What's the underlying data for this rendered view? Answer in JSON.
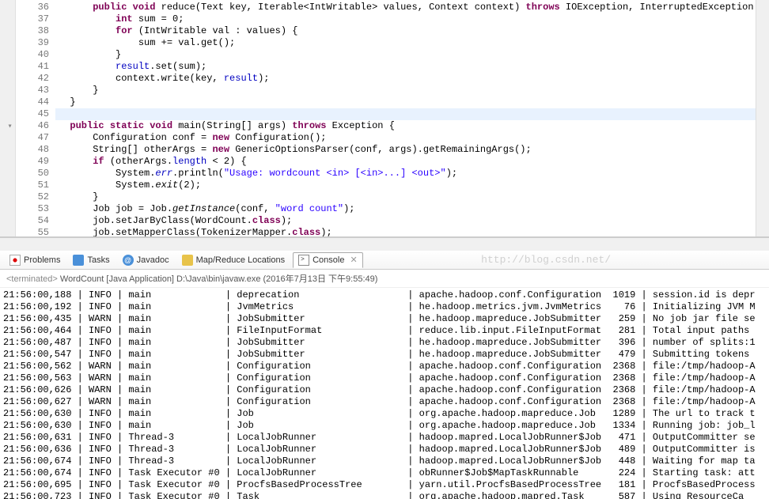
{
  "editor": {
    "gutter_start": 36,
    "lines": [
      {
        "n": 36,
        "partial": true,
        "html": "      <span class='kw'>public void</span> reduce(Text key, Iterable&lt;IntWritable&gt; values, Context context) <span class='kw'>throws</span> IOException, InterruptedException {"
      },
      {
        "n": 37,
        "html": "          <span class='kw'>int</span> sum = 0;"
      },
      {
        "n": 38,
        "html": "          <span class='kw'>for</span> (IntWritable val : values) {"
      },
      {
        "n": 39,
        "html": "              sum += val.get();"
      },
      {
        "n": 40,
        "html": "          }"
      },
      {
        "n": 41,
        "html": "          <span class='field'>result</span>.set(sum);"
      },
      {
        "n": 42,
        "html": "          context.write(key, <span class='field'>result</span>);"
      },
      {
        "n": 43,
        "html": "      }"
      },
      {
        "n": 44,
        "html": "  }"
      },
      {
        "n": 45,
        "html": " ",
        "hl": true
      },
      {
        "n": 46,
        "fold": true,
        "html": "  <span class='kw'>public static void</span> main(String[] args) <span class='kw'>throws</span> Exception {"
      },
      {
        "n": 47,
        "html": "      Configuration conf = <span class='kw'>new</span> Configuration();"
      },
      {
        "n": 48,
        "html": "      String[] otherArgs = <span class='kw'>new</span> GenericOptionsParser(conf, args).getRemainingArgs();"
      },
      {
        "n": 49,
        "html": "      <span class='kw'>if</span> (otherArgs.<span class='field'>length</span> &lt; 2) {"
      },
      {
        "n": 50,
        "html": "          System.<span class='field method-ital'>err</span>.println(<span class='str'>\"Usage: wordcount &lt;in&gt; [&lt;in&gt;...] &lt;out&gt;\"</span>);"
      },
      {
        "n": 51,
        "html": "          System.<span class='method-ital'>exit</span>(2);"
      },
      {
        "n": 52,
        "html": "      }"
      },
      {
        "n": 53,
        "html": "      Job job = Job.<span class='method-ital'>getInstance</span>(conf, <span class='str'>\"word count\"</span>);"
      },
      {
        "n": 54,
        "html": "      job.setJarByClass(WordCount.<span class='kw'>class</span>);"
      },
      {
        "n": 55,
        "html": "      job.setMapperClass(TokenizerMapper.<span class='kw'>class</span>);"
      }
    ]
  },
  "tabs": {
    "problems": "Problems",
    "tasks": "Tasks",
    "javadoc": "Javadoc",
    "mapreduce": "Map/Reduce Locations",
    "console": "Console",
    "watermark": "http://blog.csdn.net/"
  },
  "console": {
    "header_prefix": "<terminated>",
    "header_main": "WordCount [Java Application] D:\\Java\\bin\\javaw.exe (2016年7月13日 下午9:55:49)",
    "rows": [
      {
        "time": "21:56:00,188",
        "lvl": "INFO",
        "thread": "main",
        "cat": "deprecation",
        "cls": "apache.hadoop.conf.Configuration",
        "ln": "1019",
        "msg": "session.id is depr"
      },
      {
        "time": "21:56:00,192",
        "lvl": "INFO",
        "thread": "main",
        "cat": "JvmMetrics",
        "cls": "he.hadoop.metrics.jvm.JvmMetrics",
        "ln": "76",
        "msg": "Initializing JVM M"
      },
      {
        "time": "21:56:00,435",
        "lvl": "WARN",
        "thread": "main",
        "cat": "JobSubmitter",
        "cls": "he.hadoop.mapreduce.JobSubmitter",
        "ln": "259",
        "msg": "No job jar file se"
      },
      {
        "time": "21:56:00,464",
        "lvl": "INFO",
        "thread": "main",
        "cat": "FileInputFormat",
        "cls": "reduce.lib.input.FileInputFormat",
        "ln": "281",
        "msg": "Total input paths"
      },
      {
        "time": "21:56:00,487",
        "lvl": "INFO",
        "thread": "main",
        "cat": "JobSubmitter",
        "cls": "he.hadoop.mapreduce.JobSubmitter",
        "ln": "396",
        "msg": "number of splits:1"
      },
      {
        "time": "21:56:00,547",
        "lvl": "INFO",
        "thread": "main",
        "cat": "JobSubmitter",
        "cls": "he.hadoop.mapreduce.JobSubmitter",
        "ln": "479",
        "msg": "Submitting tokens"
      },
      {
        "time": "21:56:00,562",
        "lvl": "WARN",
        "thread": "main",
        "cat": "Configuration",
        "cls": "apache.hadoop.conf.Configuration",
        "ln": "2368",
        "msg": "file:/tmp/hadoop-A"
      },
      {
        "time": "21:56:00,563",
        "lvl": "WARN",
        "thread": "main",
        "cat": "Configuration",
        "cls": "apache.hadoop.conf.Configuration",
        "ln": "2368",
        "msg": "file:/tmp/hadoop-A"
      },
      {
        "time": "21:56:00,626",
        "lvl": "WARN",
        "thread": "main",
        "cat": "Configuration",
        "cls": "apache.hadoop.conf.Configuration",
        "ln": "2368",
        "msg": "file:/tmp/hadoop-A"
      },
      {
        "time": "21:56:00,627",
        "lvl": "WARN",
        "thread": "main",
        "cat": "Configuration",
        "cls": "apache.hadoop.conf.Configuration",
        "ln": "2368",
        "msg": "file:/tmp/hadoop-A"
      },
      {
        "time": "21:56:00,630",
        "lvl": "INFO",
        "thread": "main",
        "cat": "Job",
        "cls": "org.apache.hadoop.mapreduce.Job",
        "ln": "1289",
        "msg": "The url to track t"
      },
      {
        "time": "21:56:00,630",
        "lvl": "INFO",
        "thread": "main",
        "cat": "Job",
        "cls": "org.apache.hadoop.mapreduce.Job",
        "ln": "1334",
        "msg": "Running job: job_l"
      },
      {
        "time": "21:56:00,631",
        "lvl": "INFO",
        "thread": "Thread-3",
        "cat": "LocalJobRunner",
        "cls": "hadoop.mapred.LocalJobRunner$Job",
        "ln": "471",
        "msg": "OutputCommitter se"
      },
      {
        "time": "21:56:00,636",
        "lvl": "INFO",
        "thread": "Thread-3",
        "cat": "LocalJobRunner",
        "cls": "hadoop.mapred.LocalJobRunner$Job",
        "ln": "489",
        "msg": "OutputCommitter is"
      },
      {
        "time": "21:56:00,674",
        "lvl": "INFO",
        "thread": "Thread-3",
        "cat": "LocalJobRunner",
        "cls": "hadoop.mapred.LocalJobRunner$Job",
        "ln": "448",
        "msg": "Waiting for map ta"
      },
      {
        "time": "21:56:00,674",
        "lvl": "INFO",
        "thread": "Task Executor #0",
        "cat": "LocalJobRunner",
        "cls": "obRunner$Job$MapTaskRunnable",
        "ln": "224",
        "msg": "Starting task: att"
      },
      {
        "time": "21:56:00,695",
        "lvl": "INFO",
        "thread": "Task Executor #0",
        "cat": "ProcfsBasedProcessTree",
        "cls": "yarn.util.ProcfsBasedProcessTree",
        "ln": "181",
        "msg": "ProcfsBasedProcess"
      },
      {
        "time": "21:56:00,723",
        "lvl": "INFO",
        "thread": "Task Executor #0",
        "cat": "Task",
        "cls": "org.apache.hadoop.mapred.Task",
        "ln": "587",
        "msg": "Using ResourceCa"
      }
    ]
  }
}
